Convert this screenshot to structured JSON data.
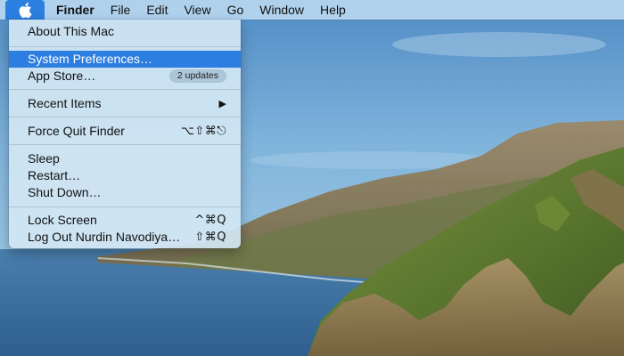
{
  "menubar": {
    "apple_icon": "apple-logo-icon",
    "items": [
      "Finder",
      "File",
      "Edit",
      "View",
      "Go",
      "Window",
      "Help"
    ]
  },
  "apple_menu": {
    "about": "About This Mac",
    "system_preferences": "System Preferences…",
    "app_store": "App Store…",
    "app_store_badge": "2 updates",
    "recent_items": "Recent Items",
    "recent_items_arrow": "▶",
    "force_quit": "Force Quit Finder",
    "force_quit_shortcut": "⌥⇧⌘⎋",
    "sleep": "Sleep",
    "restart": "Restart…",
    "shut_down": "Shut Down…",
    "lock_screen": "Lock Screen",
    "lock_screen_shortcut": "^⌘Q",
    "log_out": "Log Out Nurdin Navodiya…",
    "log_out_shortcut": "⇧⌘Q",
    "highlighted_item": "System Preferences…"
  },
  "colors": {
    "highlight": "#2c7ee0",
    "menubar": "#c4e0f5",
    "sea": "#3e6f9e",
    "sky": "#6fa3d1"
  }
}
